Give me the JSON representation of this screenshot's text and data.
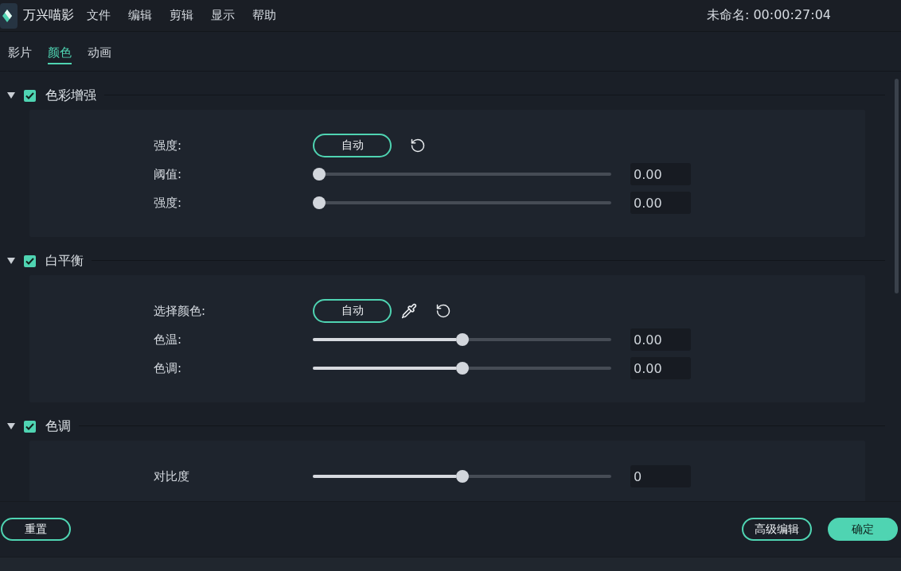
{
  "app": {
    "name": "万兴喵影"
  },
  "menu": [
    "文件",
    "编辑",
    "剪辑",
    "显示",
    "帮助"
  ],
  "project": {
    "title_time": "未命名: 00:00:27:04"
  },
  "tabs": [
    {
      "label": "影片",
      "selected": false
    },
    {
      "label": "颜色",
      "selected": true
    },
    {
      "label": "动画",
      "selected": false
    }
  ],
  "sections": [
    {
      "title": "色彩增强",
      "expanded": true,
      "checked": true,
      "rows": [
        {
          "kind": "auto",
          "label": "强度:",
          "button": "自动"
        },
        {
          "kind": "slider",
          "label": "阈值:",
          "level": 0,
          "value": "0.00"
        },
        {
          "kind": "slider",
          "label": "强度:",
          "level": 0,
          "value": "0.00"
        }
      ]
    },
    {
      "title": "白平衡",
      "expanded": true,
      "checked": true,
      "rows": [
        {
          "kind": "auto_picker",
          "label": "选择颜色:",
          "button": "自动"
        },
        {
          "kind": "slider",
          "label": "色温:",
          "level": 0.5,
          "value": "0.00"
        },
        {
          "kind": "slider",
          "label": "色调:",
          "level": 0.5,
          "value": "0.00"
        }
      ]
    },
    {
      "title": "色调",
      "expanded": true,
      "checked": true,
      "rows": [
        {
          "kind": "slider",
          "label": "对比度",
          "level": 0.5,
          "value": "0"
        }
      ]
    }
  ],
  "footer": {
    "reset_button": "重置",
    "actions": [
      {
        "label": "高级编辑",
        "kind": "outline"
      },
      {
        "label": "确定",
        "kind": "filled"
      }
    ]
  }
}
